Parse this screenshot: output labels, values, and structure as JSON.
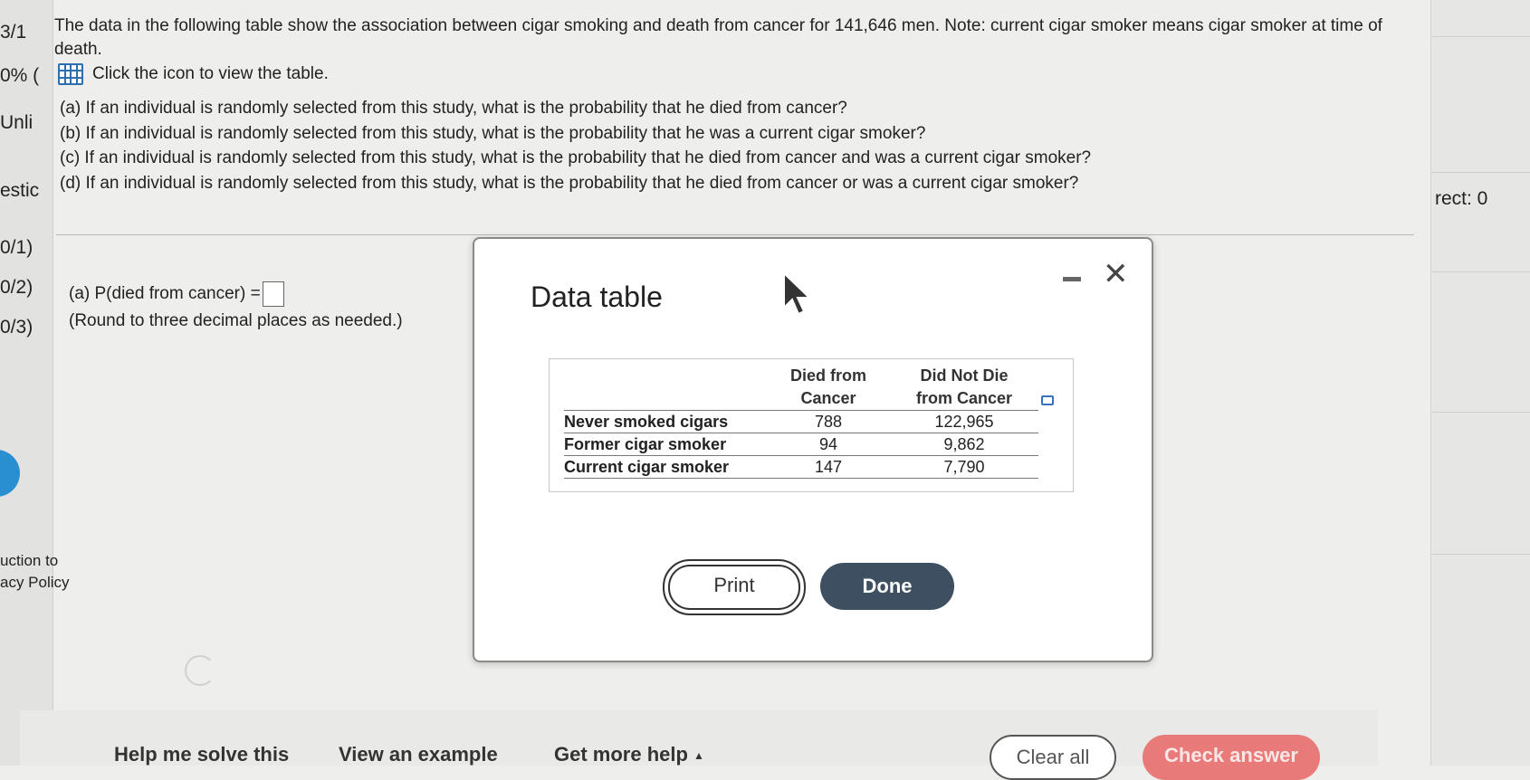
{
  "left_fragments": [
    "3/1",
    "0% (",
    "Unli",
    "estic",
    "0/1)",
    "0/2)",
    "0/3)",
    "uction to",
    "acy Policy"
  ],
  "right_fragment": "rect: 0",
  "problem": {
    "intro": "The data in the following table show the association between cigar smoking and death from cancer for 141,646 men. Note: current cigar smoker means cigar smoker at time of death.",
    "icon_prompt": "Click the icon to view the table.",
    "questions": [
      "(a) If an individual is randomly selected from this study, what is the probability that he died from cancer?",
      "(b) If an individual is randomly selected from this study, what is the probability that he was a current cigar smoker?",
      "(c) If an individual is randomly selected from this study, what is the probability that he died from cancer and was a current cigar smoker?",
      "(d) If an individual is randomly selected from this study, what is the probability that he died from cancer or was a current cigar smoker?"
    ],
    "answer_label": "(a) P(died from cancer) =",
    "answer_note": "(Round to three decimal places as needed.)"
  },
  "modal": {
    "title": "Data table",
    "table": {
      "headers": [
        "Died from Cancer",
        "Did Not Die from Cancer"
      ],
      "header_lines": [
        [
          "Died from",
          "Cancer"
        ],
        [
          "Did Not Die",
          "from Cancer"
        ]
      ],
      "rows": [
        {
          "label": "Never smoked cigars",
          "values": [
            "788",
            "122,965"
          ]
        },
        {
          "label": "Former cigar smoker",
          "values": [
            "94",
            "9,862"
          ]
        },
        {
          "label": "Current cigar smoker",
          "values": [
            "147",
            "7,790"
          ]
        }
      ]
    },
    "print_label": "Print",
    "done_label": "Done"
  },
  "footer": {
    "help_solve": "Help me solve this",
    "view_example": "View an example",
    "more_help": "Get more help",
    "more_help_caret": "▲",
    "clear_all": "Clear all",
    "check_answer": "Check answer"
  },
  "colors": {
    "done_button": "#3d4f60",
    "check_answer_button": "#e87a7a",
    "table_icon": "#2f6fb0",
    "accent_dot": "#2a8fd0"
  }
}
